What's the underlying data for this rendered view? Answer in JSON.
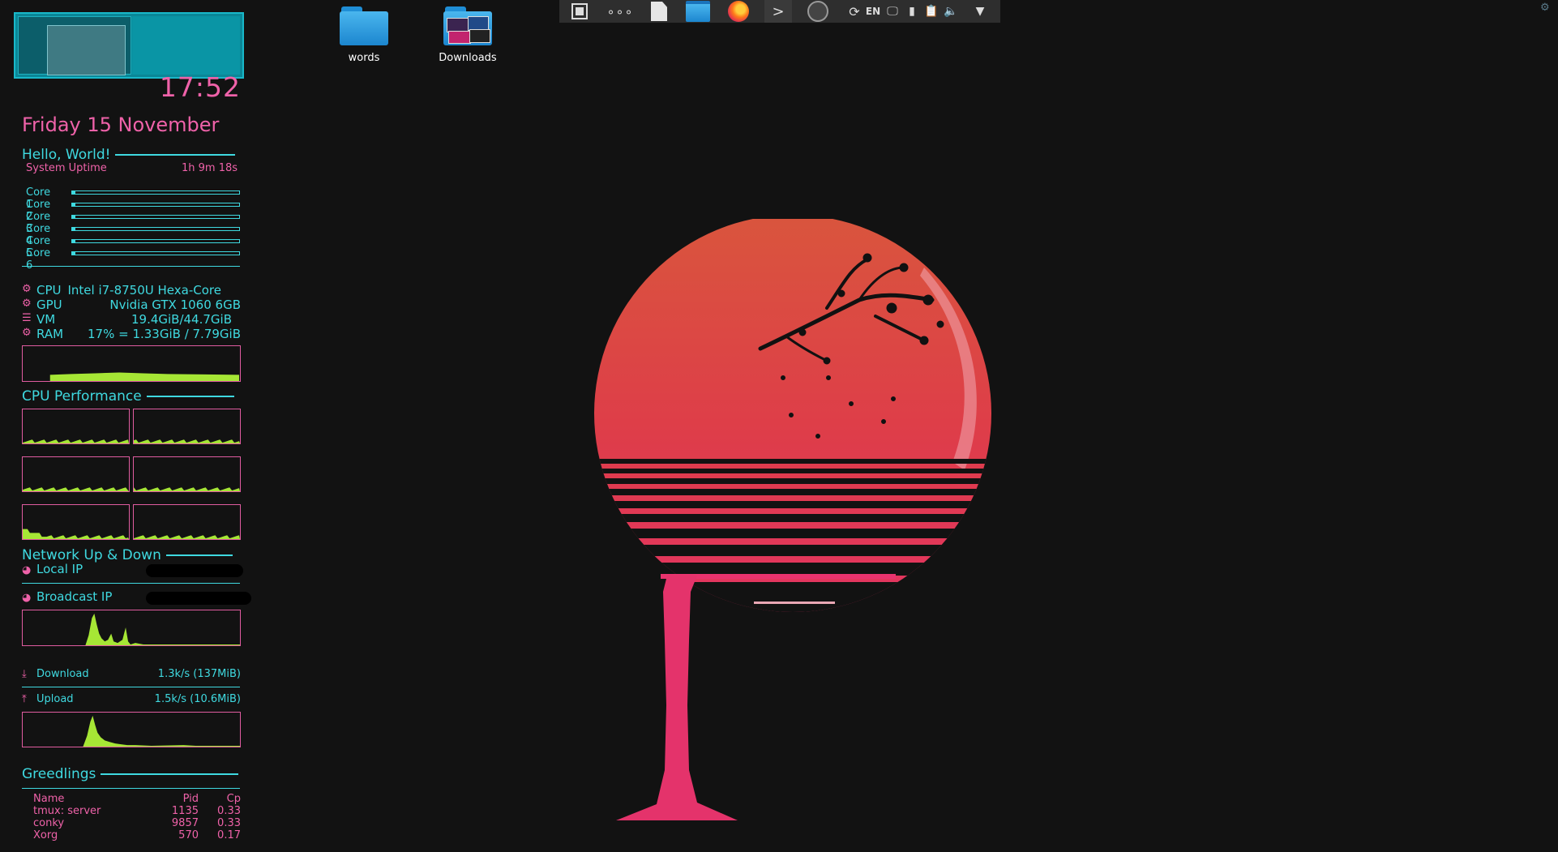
{
  "conky": {
    "time": "17:52",
    "date": "Friday 15 November",
    "greeting": "Hello, World!",
    "uptime_label": "System Uptime",
    "uptime_value": "1h 9m 18s",
    "cores": [
      {
        "label": "Core 1",
        "usage": 0.01
      },
      {
        "label": "Core 2",
        "usage": 0.02
      },
      {
        "label": "Core 3",
        "usage": 0.01
      },
      {
        "label": "Core 4",
        "usage": 0.02
      },
      {
        "label": "Core 5",
        "usage": 0.01
      },
      {
        "label": "Core 6",
        "usage": 0.01
      }
    ],
    "specs": {
      "cpu_label": "CPU",
      "cpu_value": "Intel i7-8750U Hexa-Core",
      "gpu_label": "GPU",
      "gpu_value": "Nvidia GTX 1060 6GB",
      "vm_label": "VM",
      "vm_value": "19.4GiB/44.7GiB",
      "ram_label": "RAM",
      "ram_value": "17% = 1.33GiB / 7.79GiB"
    },
    "cpu_performance_title": "CPU Performance",
    "network_title": "Network Up & Down",
    "local_ip_label": "Local IP",
    "broadcast_ip_label": "Broadcast IP",
    "download_label": "Download",
    "download_value": "1.3k/s (137MiB)",
    "upload_label": "Upload",
    "upload_value": "1.5k/s (10.6MiB)",
    "greedlings_title": "Greedlings",
    "process_headers": [
      "Name",
      "Pid",
      "Cp"
    ],
    "processes": [
      {
        "name": "tmux: server",
        "pid": "1135",
        "cp": "0.33"
      },
      {
        "name": "conky",
        "pid": "9857",
        "cp": "0.33"
      },
      {
        "name": "Xorg",
        "pid": "570",
        "cp": "0.17"
      }
    ]
  },
  "desktop": {
    "icons": [
      {
        "label": "words",
        "icon": "folder-icon"
      },
      {
        "label": "Downloads",
        "icon": "folder-image-icon"
      }
    ]
  },
  "taskbar": {
    "keyboard_layout": "EN"
  },
  "colors": {
    "accent_cyan": "#3fd9e0",
    "accent_pink": "#ef62a9",
    "graph_green": "#a6e635",
    "background": "#121212"
  }
}
